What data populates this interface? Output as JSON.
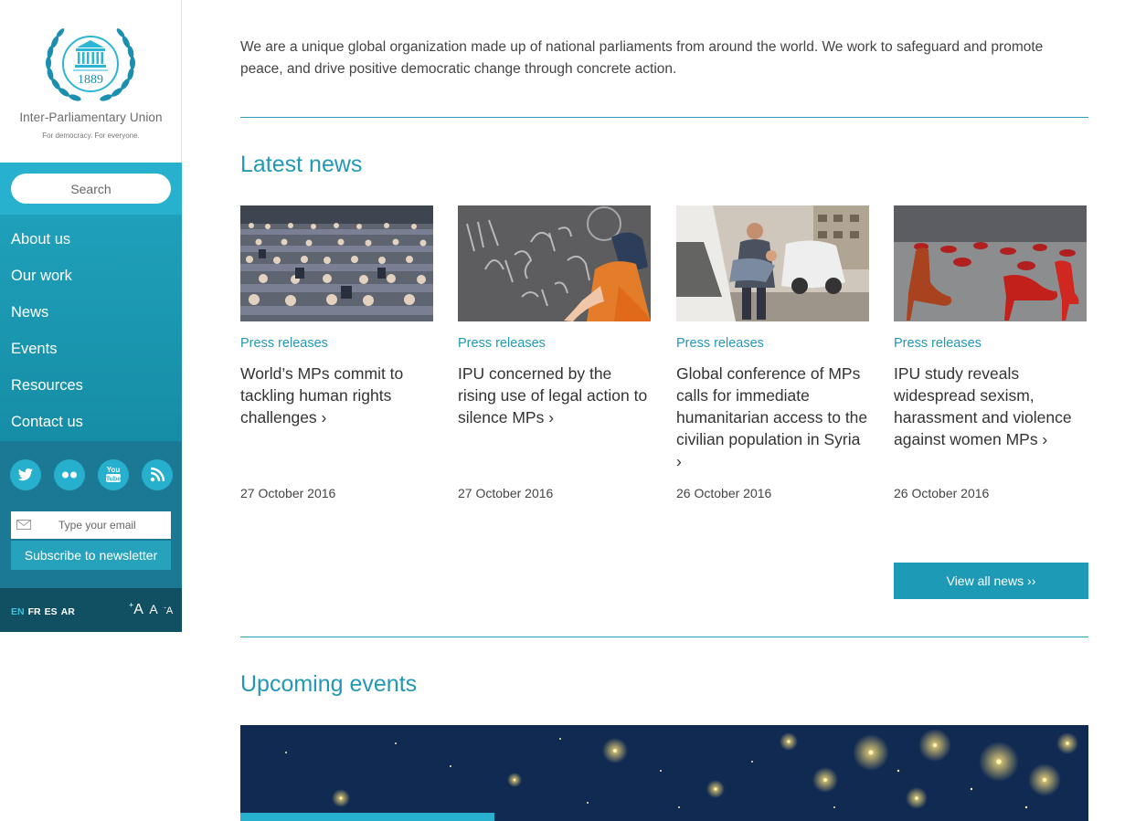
{
  "brand": {
    "logo_year": "1889",
    "name": "Inter-Parliamentary Union",
    "tagline": "For democracy. For everyone.",
    "accent_color": "#2299b4"
  },
  "search": {
    "placeholder": "Search"
  },
  "nav": {
    "items": [
      {
        "label": "About us"
      },
      {
        "label": "Our work"
      },
      {
        "label": "News"
      },
      {
        "label": "Events"
      },
      {
        "label": "Resources"
      },
      {
        "label": "Contact us"
      }
    ]
  },
  "social": {
    "icons": [
      "twitter-icon",
      "flickr-icon",
      "youtube-icon",
      "rss-icon"
    ]
  },
  "newsletter": {
    "email_placeholder": "Type your email",
    "subscribe_label": "Subscribe to newsletter"
  },
  "languages": {
    "items": [
      "EN",
      "FR",
      "ES",
      "AR"
    ],
    "active": "EN"
  },
  "font_size": {
    "increase": "A",
    "increase_sign": "+",
    "normal": "A",
    "decrease": "A",
    "decrease_sign": "-"
  },
  "intro": {
    "text": "We are a unique global organization made up of national parliaments from around the world. We work to safeguard and promote peace, and drive positive democratic change through concrete action."
  },
  "news": {
    "title": "Latest news",
    "cards": [
      {
        "category": "Press releases",
        "title": "World’s MPs commit to tackling human rights challenges ›",
        "date": "27 October 2016"
      },
      {
        "category": "Press releases",
        "title": "IPU concerned by the rising use of legal action to silence MPs ›",
        "date": "27 October 2016"
      },
      {
        "category": "Press releases",
        "title": "Global conference of MPs calls for immediate humanitarian access to the civilian population in Syria ›",
        "date": "26 October 2016"
      },
      {
        "category": "Press releases",
        "title": "IPU study reveals widespread sexism, harassment and violence against women MPs ›",
        "date": "26 October 2016"
      }
    ],
    "view_all_label": "View all news ››"
  },
  "events": {
    "title": "Upcoming events"
  }
}
